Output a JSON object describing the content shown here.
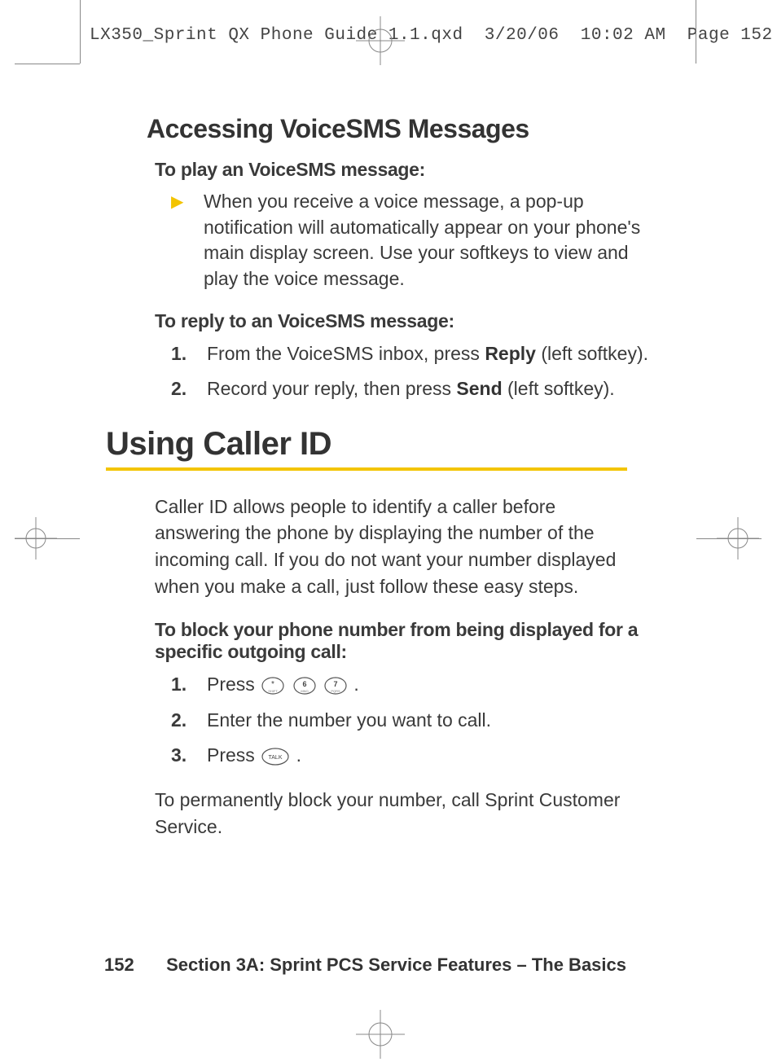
{
  "header": {
    "filename": "LX350_Sprint QX Phone Guide_1.1.qxd",
    "date": "3/20/06",
    "time": "10:02 AM",
    "page_label": "Page 152"
  },
  "section_voicesms": {
    "heading": "Accessing VoiceSMS Messages",
    "play_label": "To play an VoiceSMS message:",
    "play_bullet": "When you receive a voice message, a pop-up notification will automatically appear on your phone's main display screen. Use your softkeys to view and play the voice message.",
    "reply_label": "To reply to an VoiceSMS message:",
    "reply_steps": [
      {
        "num": "1.",
        "pre": "From the VoiceSMS inbox, press ",
        "bold": "Reply",
        "post": " (left softkey)."
      },
      {
        "num": "2.",
        "pre": "Record your reply, then press ",
        "bold": "Send",
        "post": " (left softkey)."
      }
    ]
  },
  "section_callerid": {
    "heading": "Using Caller ID",
    "intro": "Caller ID allows people to identify a caller before answering the phone by displaying the number of the incoming call. If you do not want your number displayed when you make a call, just follow these easy steps.",
    "block_label": "To block your phone number from being displayed for a specific outgoing call:",
    "steps": {
      "s1_num": "1.",
      "s1_pre": "Press ",
      "s1_keys": [
        "star",
        "6",
        "7"
      ],
      "s1_post": " .",
      "s2_num": "2.",
      "s2_text": "Enter the number you want to call.",
      "s3_num": "3.",
      "s3_pre": "Press ",
      "s3_key": "TALK",
      "s3_post": " ."
    },
    "perm_block": "To permanently block your number, call Sprint Customer Service."
  },
  "footer": {
    "page_number": "152",
    "section_label": "Section 3A: Sprint PCS Service Features – The Basics"
  }
}
